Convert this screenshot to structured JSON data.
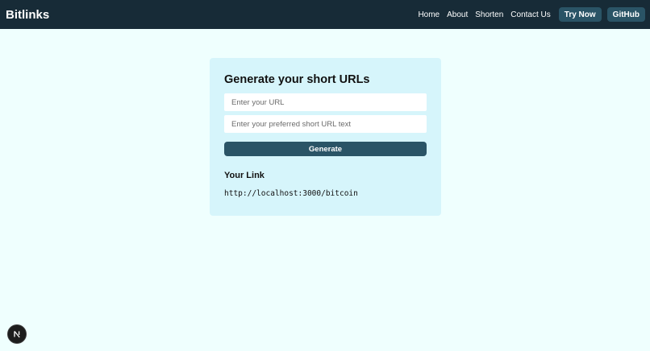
{
  "nav": {
    "brand": "Bitlinks",
    "links": [
      "Home",
      "About",
      "Shorten",
      "Contact Us"
    ],
    "try_now": "Try Now",
    "github": "GitHub"
  },
  "form": {
    "title": "Generate your short URLs",
    "url_placeholder": "Enter your URL",
    "short_placeholder": "Enter your preferred short URL text",
    "generate_label": "Generate"
  },
  "result": {
    "heading": "Your Link",
    "link": "http://localhost:3000/bitcoin"
  },
  "colors": {
    "navbar": "#172b37",
    "accent": "#2a5466",
    "card": "#d6f5fb",
    "page": "#effffe"
  },
  "badge": {
    "icon": "nextjs-icon"
  }
}
